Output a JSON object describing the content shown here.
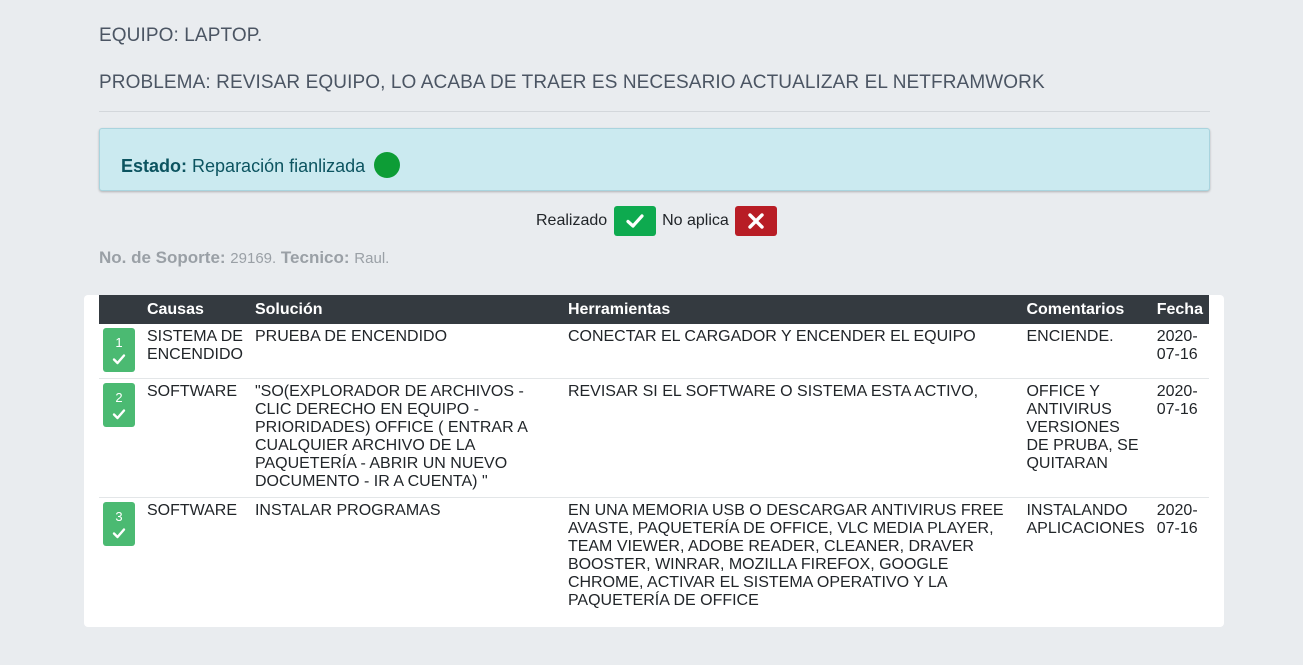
{
  "header": {
    "equipo": "EQUIPO: LAPTOP.",
    "problema": "PROBLEMA: REVISAR EQUIPO, LO ACABA DE TRAER ES NECESARIO ACTUALIZAR EL NETFRAMWORK"
  },
  "status": {
    "label": "Estado:",
    "value": "Reparación fianlizada",
    "dot_color": "#0d9d36",
    "icon": "status-dot-icon"
  },
  "legend": {
    "done_label": "Realizado",
    "done_icon": "check-icon",
    "done_color": "#0eaa4f",
    "na_label": "No aplica",
    "na_icon": "close-icon",
    "na_color": "#b81d25"
  },
  "meta": {
    "soporte_label": "No. de Soporte:",
    "soporte_value": "29169.",
    "tecnico_label": "Tecnico:",
    "tecnico_value": "Raul."
  },
  "table": {
    "columns": [
      "",
      "Causas",
      "Solución",
      "Herramientas",
      "Comentarios",
      "Fecha"
    ],
    "rows": [
      {
        "num": "1",
        "status_icon": "check-icon",
        "causa": "SISTEMA DE ENCENDIDO",
        "solucion": "PRUEBA DE ENCENDIDO",
        "herramientas": "CONECTAR EL CARGADOR Y ENCENDER EL EQUIPO",
        "comentarios": "ENCIENDE.",
        "fecha": "2020-07-16"
      },
      {
        "num": "2",
        "status_icon": "check-icon",
        "causa": "SOFTWARE",
        "solucion": "\"SO(EXPLORADOR DE ARCHIVOS - CLIC DERECHO EN EQUIPO - PRIORIDADES) OFFICE ( ENTRAR A CUALQUIER ARCHIVO DE LA PAQUETERÍA - ABRIR UN NUEVO DOCUMENTO - IR A CUENTA) \"",
        "herramientas": "REVISAR SI EL SOFTWARE O SISTEMA ESTA ACTIVO,",
        "comentarios": "OFFICE Y ANTIVIRUS VERSIONES DE PRUBA, SE QUITARAN",
        "fecha": "2020-07-16"
      },
      {
        "num": "3",
        "status_icon": "check-icon",
        "causa": "SOFTWARE",
        "solucion": "INSTALAR PROGRAMAS",
        "herramientas": "EN UNA MEMORIA USB O DESCARGAR ANTIVIRUS FREE AVASTE, PAQUETERÍA DE OFFICE, VLC MEDIA PLAYER, TEAM VIEWER, ADOBE READER, CLEANER, DRAVER BOOSTER, WINRAR, MOZILLA FIREFOX, GOOGLE CHROME, ACTIVAR EL SISTEMA OPERATIVO Y LA PAQUETERÍA DE OFFICE",
        "comentarios": "INSTALANDO APLICACIONES",
        "fecha": "2020-07-16"
      }
    ]
  }
}
